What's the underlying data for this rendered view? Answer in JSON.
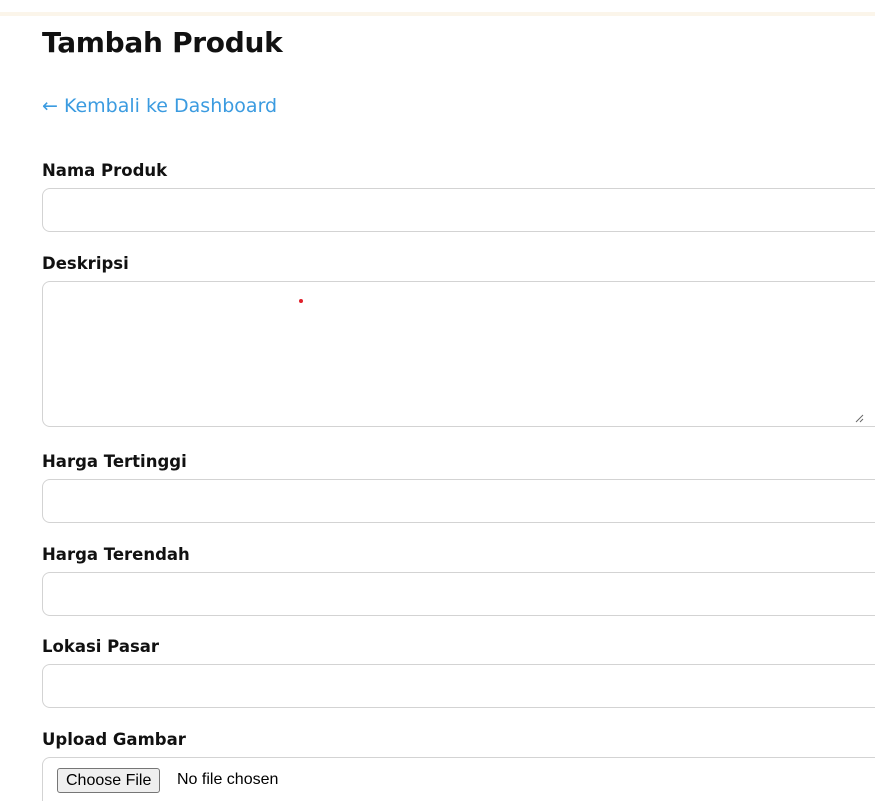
{
  "page": {
    "title": "Tambah Produk",
    "back_link": "← Kembali ke Dashboard"
  },
  "form": {
    "nama_produk": {
      "label": "Nama Produk",
      "value": ""
    },
    "deskripsi": {
      "label": "Deskripsi",
      "value": ""
    },
    "harga_tertinggi": {
      "label": "Harga Tertinggi",
      "value": ""
    },
    "harga_terendah": {
      "label": "Harga Terendah",
      "value": ""
    },
    "lokasi_pasar": {
      "label": "Lokasi Pasar",
      "value": ""
    },
    "upload_gambar": {
      "label": "Upload Gambar",
      "button_label": "Choose File",
      "status": "No file chosen"
    }
  },
  "colors": {
    "link": "#3b9be0",
    "border": "#d3d3d3",
    "marker_dot": "#e0202b"
  }
}
